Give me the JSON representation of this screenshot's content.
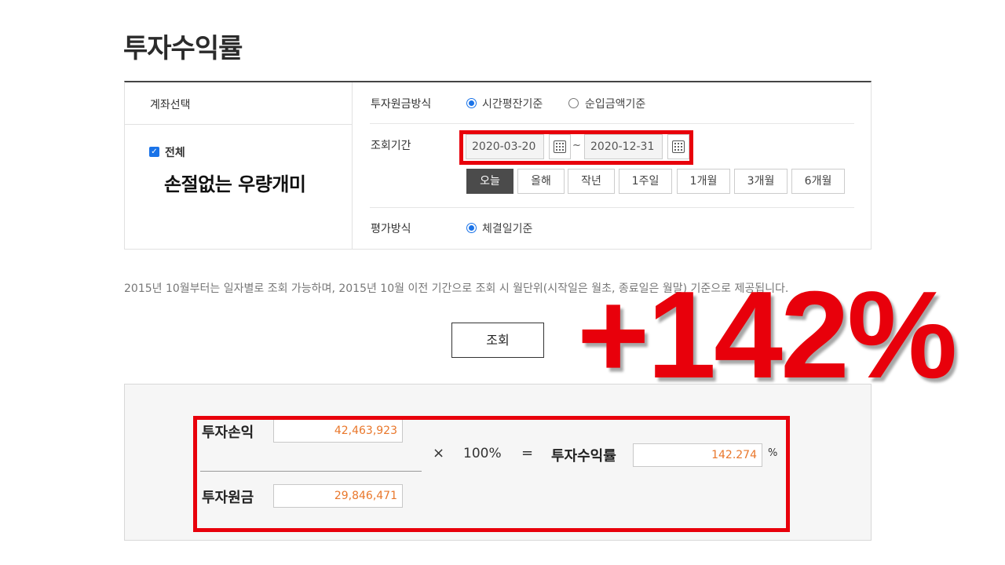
{
  "page": {
    "title": "투자수익률"
  },
  "account": {
    "section_title": "계좌선택",
    "all_label": "전체",
    "all_checked": true,
    "check_mark": "✓",
    "nickname": "손절없는 우량개미"
  },
  "principal_method": {
    "label": "투자원금방식",
    "options": [
      "시간평잔기준",
      "순입금액기준"
    ],
    "selected": "시간평잔기준"
  },
  "period": {
    "label": "조회기간",
    "start_date": "2020-03-20",
    "end_date": "2020-12-31",
    "separator": "~",
    "quick_buttons": [
      "오늘",
      "올해",
      "작년",
      "1주일",
      "1개월",
      "3개월",
      "6개월"
    ],
    "active_button": "오늘"
  },
  "evaluation_method": {
    "label": "평가방식",
    "options": [
      "체결일기준"
    ],
    "selected": "체결일기준"
  },
  "notice": "2015년 10월부터는 일자별로 조회 가능하며, 2015년 10월 이전 기간으로 조회 시 월단위(시작일은 월초, 종료일은 월말) 기준으로 제공됩니다.",
  "search_button": "조회",
  "overlay_return": "+142%",
  "result": {
    "profit_label": "투자손익",
    "profit_value": "42,463,923",
    "principal_label": "투자원금",
    "principal_value": "29,846,471",
    "multiply_symbol": "×",
    "hundred_pct": "100%",
    "equals_symbol": "=",
    "rate_label": "투자수익률",
    "rate_value": "142.274",
    "unit": "%"
  },
  "colors": {
    "highlight_red": "#e8000b",
    "accent_blue": "#1a73e8",
    "value_orange": "#e9772b",
    "active_button_bg": "#4b4b4b"
  }
}
